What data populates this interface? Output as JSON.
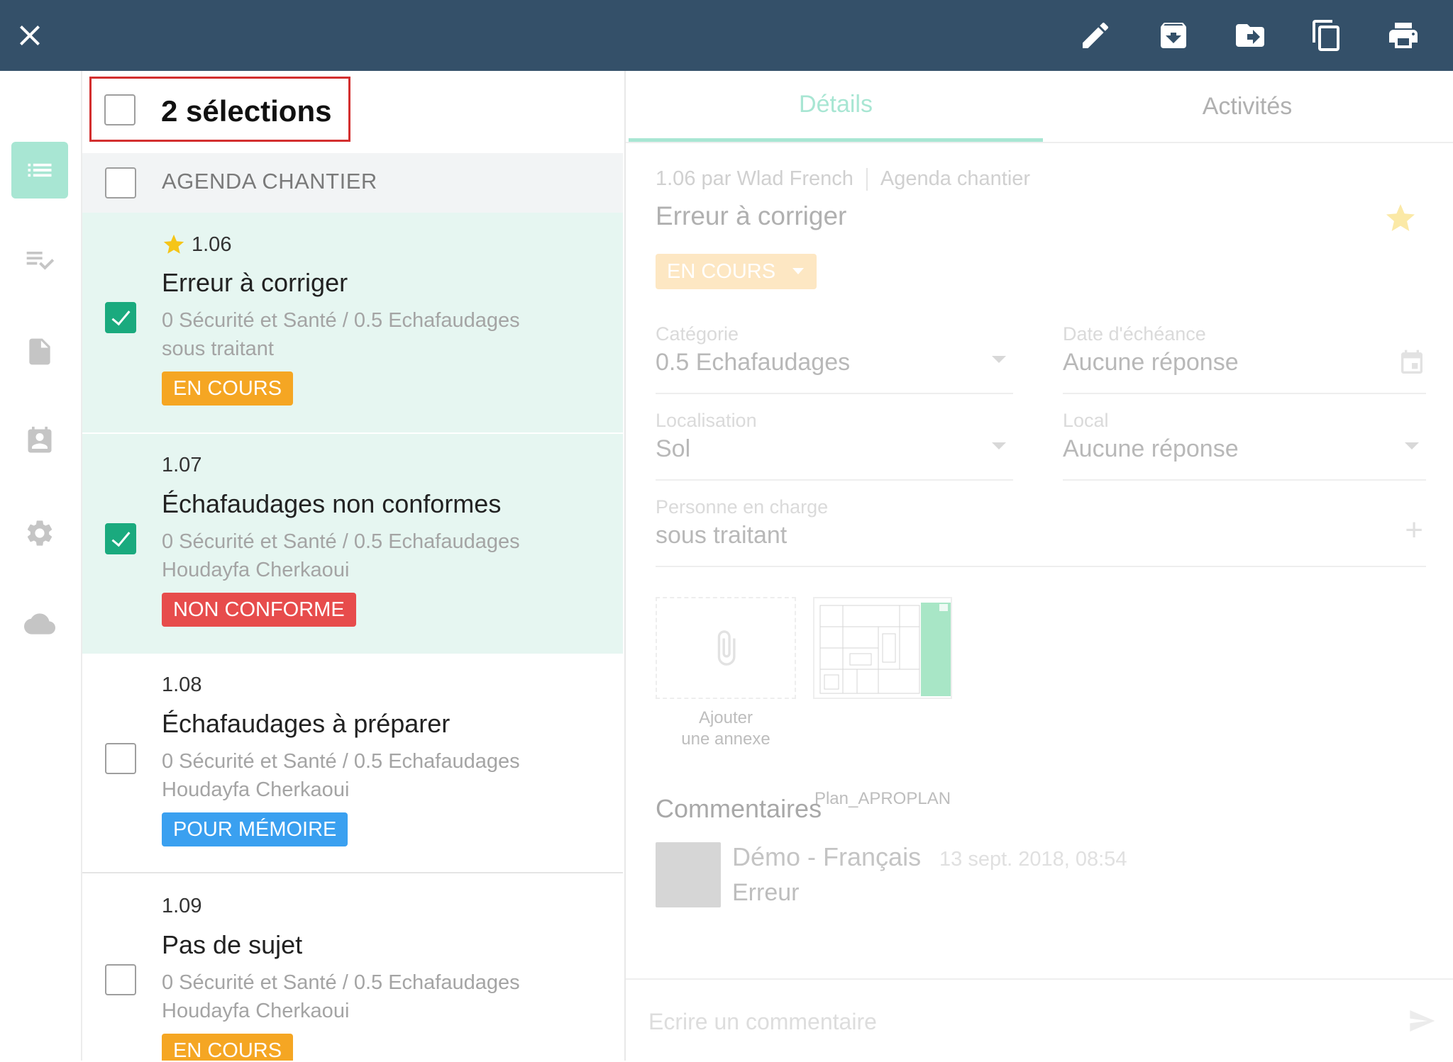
{
  "toolbar": {
    "close_icon": "close-icon",
    "actions": [
      "edit-icon",
      "archive-icon",
      "move-icon",
      "copy-icon",
      "print-icon"
    ]
  },
  "rail": {
    "items": [
      "list-icon",
      "checklist-icon",
      "document-icon",
      "contacts-icon",
      "settings-icon",
      "cloud-icon"
    ],
    "active": "list-icon",
    "accent": "#a8e6d3"
  },
  "selection": {
    "title": "2 sélections"
  },
  "group": {
    "title": "AGENDA CHANTIER"
  },
  "items": [
    {
      "number": "1.06",
      "starred": true,
      "title": "Erreur à corriger",
      "path": "0 Sécurité et Santé / 0.5 Echafaudages",
      "assignee": "sous traitant",
      "status": "EN COURS",
      "status_color": "#f5a623",
      "checked": true
    },
    {
      "number": "1.07",
      "starred": false,
      "title": "Échafaudages non conformes",
      "path": "0 Sécurité et Santé / 0.5 Echafaudages",
      "assignee": "Houdayfa Cherkaoui",
      "status": "NON CONFORME",
      "status_color": "#e74c4c",
      "checked": true
    },
    {
      "number": "1.08",
      "starred": false,
      "title": "Échafaudages à préparer",
      "path": "0 Sécurité et Santé / 0.5 Echafaudages",
      "assignee": "Houdayfa Cherkaoui",
      "status": "POUR MÉMOIRE",
      "status_color": "#3aa0f0",
      "checked": false
    },
    {
      "number": "1.09",
      "starred": false,
      "title": "Pas de sujet",
      "path": "0 Sécurité et Santé / 0.5 Echafaudages",
      "assignee": "Houdayfa Cherkaoui",
      "status": "EN COURS",
      "status_color": "#f5a623",
      "checked": false
    }
  ],
  "detail": {
    "tabs": [
      "Détails",
      "Activités"
    ],
    "meta_left": "1.06 par Wlad French",
    "meta_right": "Agenda chantier",
    "title": "Erreur à corriger",
    "status": "EN COURS",
    "fields": {
      "category": {
        "label": "Catégorie",
        "value": "0.5 Echafaudages"
      },
      "due": {
        "label": "Date d'échéance",
        "value": "Aucune réponse"
      },
      "location": {
        "label": "Localisation",
        "value": "Sol"
      },
      "local": {
        "label": "Local",
        "value": "Aucune réponse"
      },
      "person": {
        "label": "Personne en charge",
        "value": "sous traitant"
      }
    },
    "attachments": {
      "add_line1": "Ajouter",
      "add_line2": "une annexe",
      "plan_label": "Plan_APROPLAN"
    },
    "comments": {
      "title": "Commentaires",
      "author": "Démo - Français",
      "time": "13 sept. 2018, 08:54",
      "text": "Erreur"
    },
    "composer_placeholder": "Ecrire un commentaire"
  }
}
